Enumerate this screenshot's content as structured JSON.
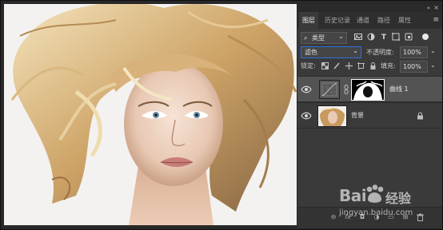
{
  "panel": {
    "collapse_glyph": "«",
    "close_glyph": "×",
    "tabs": [
      {
        "label": "图层",
        "active": true
      },
      {
        "label": "历史记录",
        "active": false
      },
      {
        "label": "通道",
        "active": false
      },
      {
        "label": "路径",
        "active": false
      },
      {
        "label": "属性",
        "active": false
      }
    ],
    "menu_glyph": "≡",
    "filter": {
      "search_glyph": "⌕",
      "kind_label": "类型",
      "arrow": "⌄"
    },
    "filter_icons": [
      "image-filter-icon",
      "adjustment-filter-icon",
      "type-filter-icon",
      "shape-filter-icon",
      "smart-object-filter-icon",
      "filter-toggle-icon"
    ],
    "blend_mode": "滤色",
    "opacity_label": "不透明度:",
    "opacity_value": "100%",
    "lock_label": "锁定:",
    "fill_label": "填充:",
    "fill_value": "100%",
    "layers": [
      {
        "name": "曲线 1",
        "visible": true,
        "selected": true
      },
      {
        "name": "背景",
        "visible": true,
        "selected": false,
        "locked": true
      }
    ],
    "bottom_icons": [
      "link-layers-icon",
      "fx-icon",
      "add-mask-icon",
      "new-adjustment-icon",
      "new-group-icon",
      "new-layer-icon",
      "delete-layer-icon"
    ],
    "bottom_glyphs": [
      "⊖",
      "fx",
      "◘",
      "◑",
      "▭",
      "⊞",
      "🗑"
    ]
  },
  "watermark": {
    "brand": "Bai",
    "brand2": "经验",
    "url": "jingyan.baidu.com"
  },
  "colors": {
    "accent": "#2e6fd9",
    "panel": "#3a3a3a",
    "selected": "#535353"
  }
}
